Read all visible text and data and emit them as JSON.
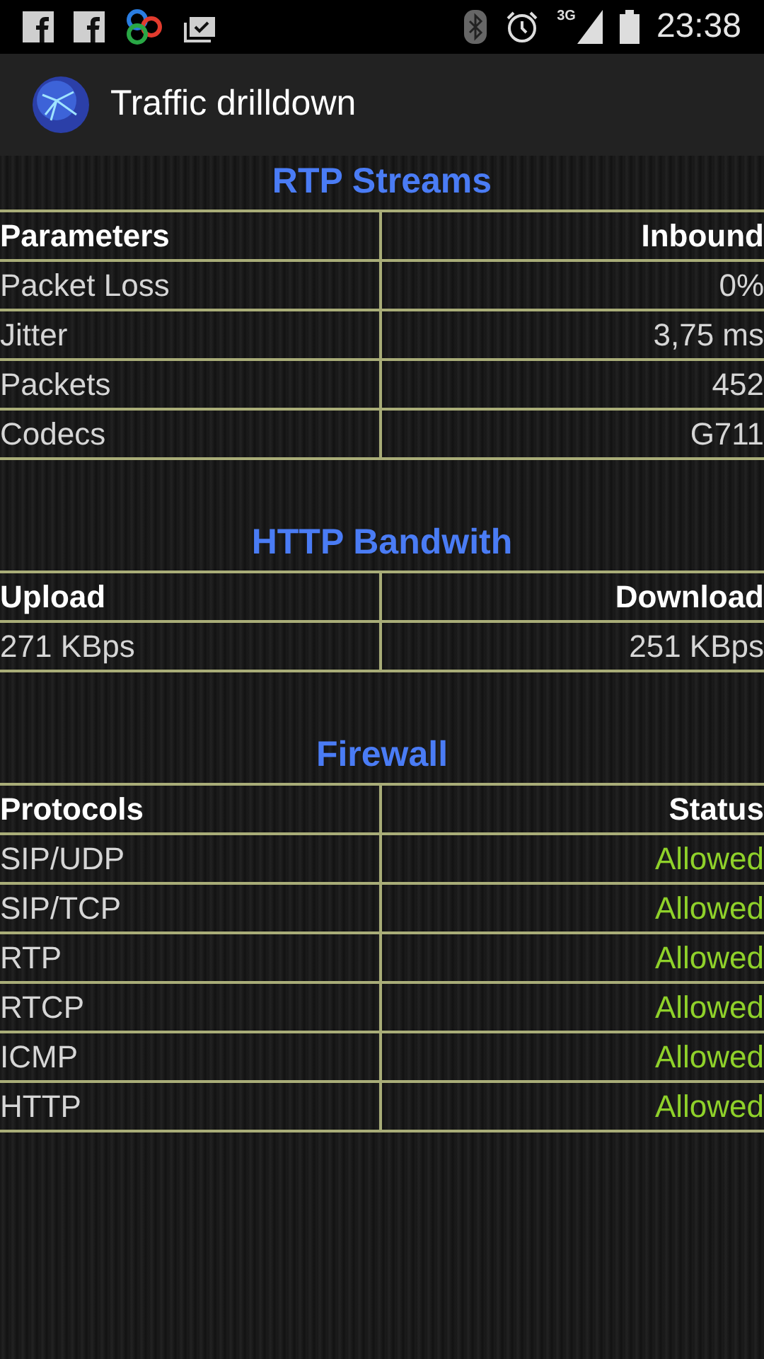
{
  "status_bar": {
    "time": "23:38",
    "network": "3G"
  },
  "app_bar": {
    "title": "Traffic drilldown"
  },
  "sections": [
    {
      "title": "RTP Streams",
      "kind": "plain",
      "columns": [
        "Parameters",
        "Inbound"
      ],
      "rows": [
        [
          "Packet Loss",
          "0%"
        ],
        [
          "Jitter",
          "3,75 ms"
        ],
        [
          "Packets",
          "452"
        ],
        [
          "Codecs",
          "G711"
        ]
      ]
    },
    {
      "title": "HTTP Bandwith",
      "kind": "plain",
      "columns": [
        "Upload",
        "Download"
      ],
      "rows": [
        [
          "271 KBps",
          "251 KBps"
        ]
      ]
    },
    {
      "title": "Firewall",
      "kind": "status",
      "columns": [
        "Protocols",
        "Status"
      ],
      "rows": [
        [
          "SIP/UDP",
          "Allowed"
        ],
        [
          "SIP/TCP",
          "Allowed"
        ],
        [
          "RTP",
          "Allowed"
        ],
        [
          "RTCP",
          "Allowed"
        ],
        [
          "ICMP",
          "Allowed"
        ],
        [
          "HTTP",
          "Allowed"
        ]
      ]
    }
  ]
}
